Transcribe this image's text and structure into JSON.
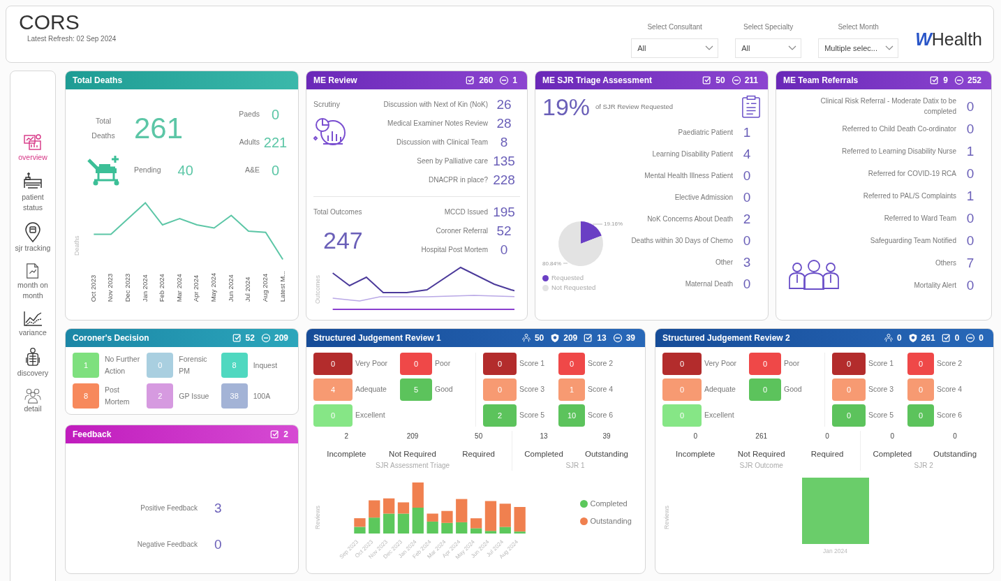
{
  "header": {
    "title": "CORS",
    "refresh": "Latest Refresh: 02 Sep 2024",
    "filters": [
      {
        "label": "Select Consultant",
        "value": "All"
      },
      {
        "label": "Select Specialty",
        "value": "All"
      },
      {
        "label": "Select Month",
        "value": "Multiple selec..."
      }
    ],
    "logo": {
      "mark": "W",
      "text": "Health"
    }
  },
  "sidebar": {
    "items": [
      {
        "kind": "overview",
        "label": "overview",
        "selected": true
      },
      {
        "kind": "bed",
        "label": "patient status",
        "selected": false
      },
      {
        "kind": "pin",
        "label": "sjr tracking",
        "selected": false
      },
      {
        "kind": "document",
        "label": "month on month",
        "selected": false
      },
      {
        "kind": "trend",
        "label": "variance",
        "selected": false
      },
      {
        "kind": "body",
        "label": "discovery",
        "selected": false
      },
      {
        "kind": "people",
        "label": "detail",
        "selected": false
      }
    ]
  },
  "total_deaths": {
    "title": "Total Deaths",
    "total_label": "Total Deaths",
    "total": "261",
    "pending_label": "Pending",
    "pending": "40",
    "breakdown": [
      {
        "label": "Paeds",
        "value": "0"
      },
      {
        "label": "Adults",
        "value": "221"
      },
      {
        "label": "A&E",
        "value": "0"
      }
    ],
    "trend": {
      "ylabel": "Deaths",
      "x_labels": [
        "Oct 2023",
        "Nov 2023",
        "Dec 2023",
        "Jan 2024",
        "Feb 2024",
        "Mar 2024",
        "Apr 2024",
        "May 2024",
        "Jun 2024",
        "Jul 2024",
        "Aug 2024",
        "Latest M..."
      ]
    }
  },
  "me_review": {
    "title": "ME Review",
    "stats": [
      {
        "kind": "check",
        "value": "260"
      },
      {
        "kind": "minus",
        "value": "1"
      }
    ],
    "scrutiny_label": "Scrutiny",
    "scrutiny": [
      {
        "label": "Discussion with Next of Kin (NoK)",
        "value": "26"
      },
      {
        "label": "Medical Examiner Notes Review",
        "value": "28"
      },
      {
        "label": "Discussion with Clinical Team",
        "value": "8"
      },
      {
        "label": "Seen by Palliative care",
        "value": "135"
      },
      {
        "label": "DNACPR in place?",
        "value": "228"
      }
    ],
    "outcomes_label": "Total Outcomes",
    "outcomes_total": "247",
    "outcomes": [
      {
        "label": "MCCD Issued",
        "value": "195"
      },
      {
        "label": "Coroner Referral",
        "value": "52"
      },
      {
        "label": "Hospital Post Mortem",
        "value": "0"
      }
    ],
    "trend": {
      "ylabel": "Outcomes"
    }
  },
  "sjr_triage": {
    "title": "ME SJR Triage Assessment",
    "stats": [
      {
        "kind": "check",
        "value": "50"
      },
      {
        "kind": "minus",
        "value": "211"
      }
    ],
    "percent": "19%",
    "percent_label": "of SJR Review Requested",
    "items": [
      {
        "label": "Paediatric Patient",
        "value": "1"
      },
      {
        "label": "Learning Disability Patient",
        "value": "4"
      },
      {
        "label": "Mental Health Illness Patient",
        "value": "0"
      },
      {
        "label": "Elective Admission",
        "value": "0"
      },
      {
        "label": "NoK Concerns About Death",
        "value": "2"
      },
      {
        "label": "Deaths within 30 Days of Chemo",
        "value": "0"
      },
      {
        "label": "Other",
        "value": "3"
      },
      {
        "label": "Maternal Death",
        "value": "0"
      }
    ],
    "chart_data": {
      "type": "pie",
      "categories": [
        "Requested",
        "Not Requested"
      ],
      "values": [
        19.16,
        80.84
      ],
      "value_labels": [
        "19.16%",
        "80.84%"
      ]
    }
  },
  "me_referrals": {
    "title": "ME Team Referrals",
    "stats": [
      {
        "kind": "check",
        "value": "9"
      },
      {
        "kind": "minus",
        "value": "252"
      }
    ],
    "items": [
      {
        "label": "Clinical Risk Referral - Moderate Datix to be completed",
        "value": "0"
      },
      {
        "label": "Referred to Child Death Co-ordinator",
        "value": "0"
      },
      {
        "label": "Referred to Learning Disability Nurse",
        "value": "1"
      },
      {
        "label": "Referred for COVID-19 RCA",
        "value": "0"
      },
      {
        "label": "Referred to PAL/S Complaints",
        "value": "1"
      },
      {
        "label": "Referred to Ward Team",
        "value": "0"
      },
      {
        "label": "Safeguarding Team Notified",
        "value": "0"
      },
      {
        "label": "Others",
        "value": "7"
      },
      {
        "label": "Mortality Alert",
        "value": "0"
      }
    ]
  },
  "coroners_decision": {
    "title": "Coroner's Decision",
    "stats": [
      {
        "kind": "check",
        "value": "52"
      },
      {
        "kind": "minus",
        "value": "209"
      }
    ],
    "tiles": [
      {
        "label": "No Further Action",
        "value": "1",
        "color": "#7ee07e"
      },
      {
        "label": "Forensic PM",
        "value": "0",
        "color": "#a9cfe0"
      },
      {
        "label": "Inquest",
        "value": "8",
        "color": "#4fd8c0"
      },
      {
        "label": "Post Mortem",
        "value": "8",
        "color": "#f7895c"
      },
      {
        "label": "GP Issue",
        "value": "2",
        "color": "#d69ae0"
      },
      {
        "label": "100A",
        "value": "38",
        "color": "#a3b3d6"
      }
    ]
  },
  "feedback": {
    "title": "Feedback",
    "stats": [
      {
        "kind": "check",
        "value": "2"
      }
    ],
    "items": [
      {
        "label": "Positive Feedback",
        "value": "3"
      },
      {
        "label": "Negative Feedback",
        "value": "0"
      }
    ]
  },
  "sjr_panels": [
    {
      "title": "Structured Judgement Review 1",
      "stats": [
        {
          "kind": "people",
          "value": "50"
        },
        {
          "kind": "shield",
          "value": "209"
        },
        {
          "kind": "check",
          "value": "13"
        },
        {
          "kind": "minus",
          "value": "39"
        }
      ],
      "ratings": [
        {
          "label": "Very Poor",
          "value": "0",
          "color": "#b32c2c"
        },
        {
          "label": "Poor",
          "value": "0",
          "color": "#ef4848"
        },
        {
          "label": "Adequate",
          "value": "4",
          "color": "#f79a72"
        },
        {
          "label": "Good",
          "value": "5",
          "color": "#5cc35c"
        },
        {
          "label": "Excellent",
          "value": "0",
          "color": "#86e686"
        }
      ],
      "scores": [
        {
          "label": "Score 1",
          "value": "0",
          "color": "#b32c2c"
        },
        {
          "label": "Score 2",
          "value": "0",
          "color": "#ef4848"
        },
        {
          "label": "Score 3",
          "value": "0",
          "color": "#f79a72"
        },
        {
          "label": "Score 4",
          "value": "1",
          "color": "#f79a72"
        },
        {
          "label": "Score 5",
          "value": "2",
          "color": "#5cc35c"
        },
        {
          "label": "Score 6",
          "value": "10",
          "color": "#5cc35c"
        }
      ],
      "triage": {
        "caption": "SJR Assessment Triage",
        "items": [
          {
            "value": "2",
            "label": "Incomplete"
          },
          {
            "value": "209",
            "label": "Not Required"
          },
          {
            "value": "50",
            "label": "Required"
          }
        ]
      },
      "progress": {
        "caption": "SJR 1",
        "items": [
          {
            "value": "13",
            "label": "Completed"
          },
          {
            "value": "39",
            "label": "Outstanding"
          }
        ]
      },
      "reviews_chart": {
        "ylabel": "Reviews",
        "x_labels": [
          "Sep 2023",
          "Oct 2023",
          "Nov 2023",
          "Dec 2023",
          "Jan 2024",
          "Feb 2024",
          "Mar 2024",
          "Apr 2024",
          "May 2024",
          "Jun 2024",
          "Jul 2024",
          "Aug 2024"
        ],
        "legend": [
          {
            "label": "Completed",
            "color": "#5cc85c"
          },
          {
            "label": "Outstanding",
            "color": "#f0804f"
          }
        ]
      }
    },
    {
      "title": "Structured Judgement Review 2",
      "stats": [
        {
          "kind": "people",
          "value": "0"
        },
        {
          "kind": "shield",
          "value": "261"
        },
        {
          "kind": "check",
          "value": "0"
        },
        {
          "kind": "minus",
          "value": "0"
        }
      ],
      "ratings": [
        {
          "label": "Very Poor",
          "value": "0",
          "color": "#b32c2c"
        },
        {
          "label": "Poor",
          "value": "0",
          "color": "#ef4848"
        },
        {
          "label": "Adequate",
          "value": "0",
          "color": "#f79a72"
        },
        {
          "label": "Good",
          "value": "0",
          "color": "#5cc35c"
        },
        {
          "label": "Excellent",
          "value": "0",
          "color": "#86e686"
        }
      ],
      "scores": [
        {
          "label": "Score 1",
          "value": "0",
          "color": "#b32c2c"
        },
        {
          "label": "Score 2",
          "value": "0",
          "color": "#ef4848"
        },
        {
          "label": "Score 3",
          "value": "0",
          "color": "#f79a72"
        },
        {
          "label": "Score 4",
          "value": "0",
          "color": "#f79a72"
        },
        {
          "label": "Score 5",
          "value": "0",
          "color": "#5cc35c"
        },
        {
          "label": "Score 6",
          "value": "0",
          "color": "#5cc35c"
        }
      ],
      "triage": {
        "caption": "SJR Outcome",
        "items": [
          {
            "value": "0",
            "label": "Incomplete"
          },
          {
            "value": "261",
            "label": "Not Required"
          },
          {
            "value": "0",
            "label": "Required"
          }
        ]
      },
      "progress": {
        "caption": "SJR 2",
        "items": [
          {
            "value": "0",
            "label": "Completed"
          },
          {
            "value": "0",
            "label": "Outstanding"
          }
        ]
      },
      "reviews_chart": {
        "ylabel": "Reviews",
        "x_labels": [
          "Jan 2024"
        ]
      }
    }
  ]
}
